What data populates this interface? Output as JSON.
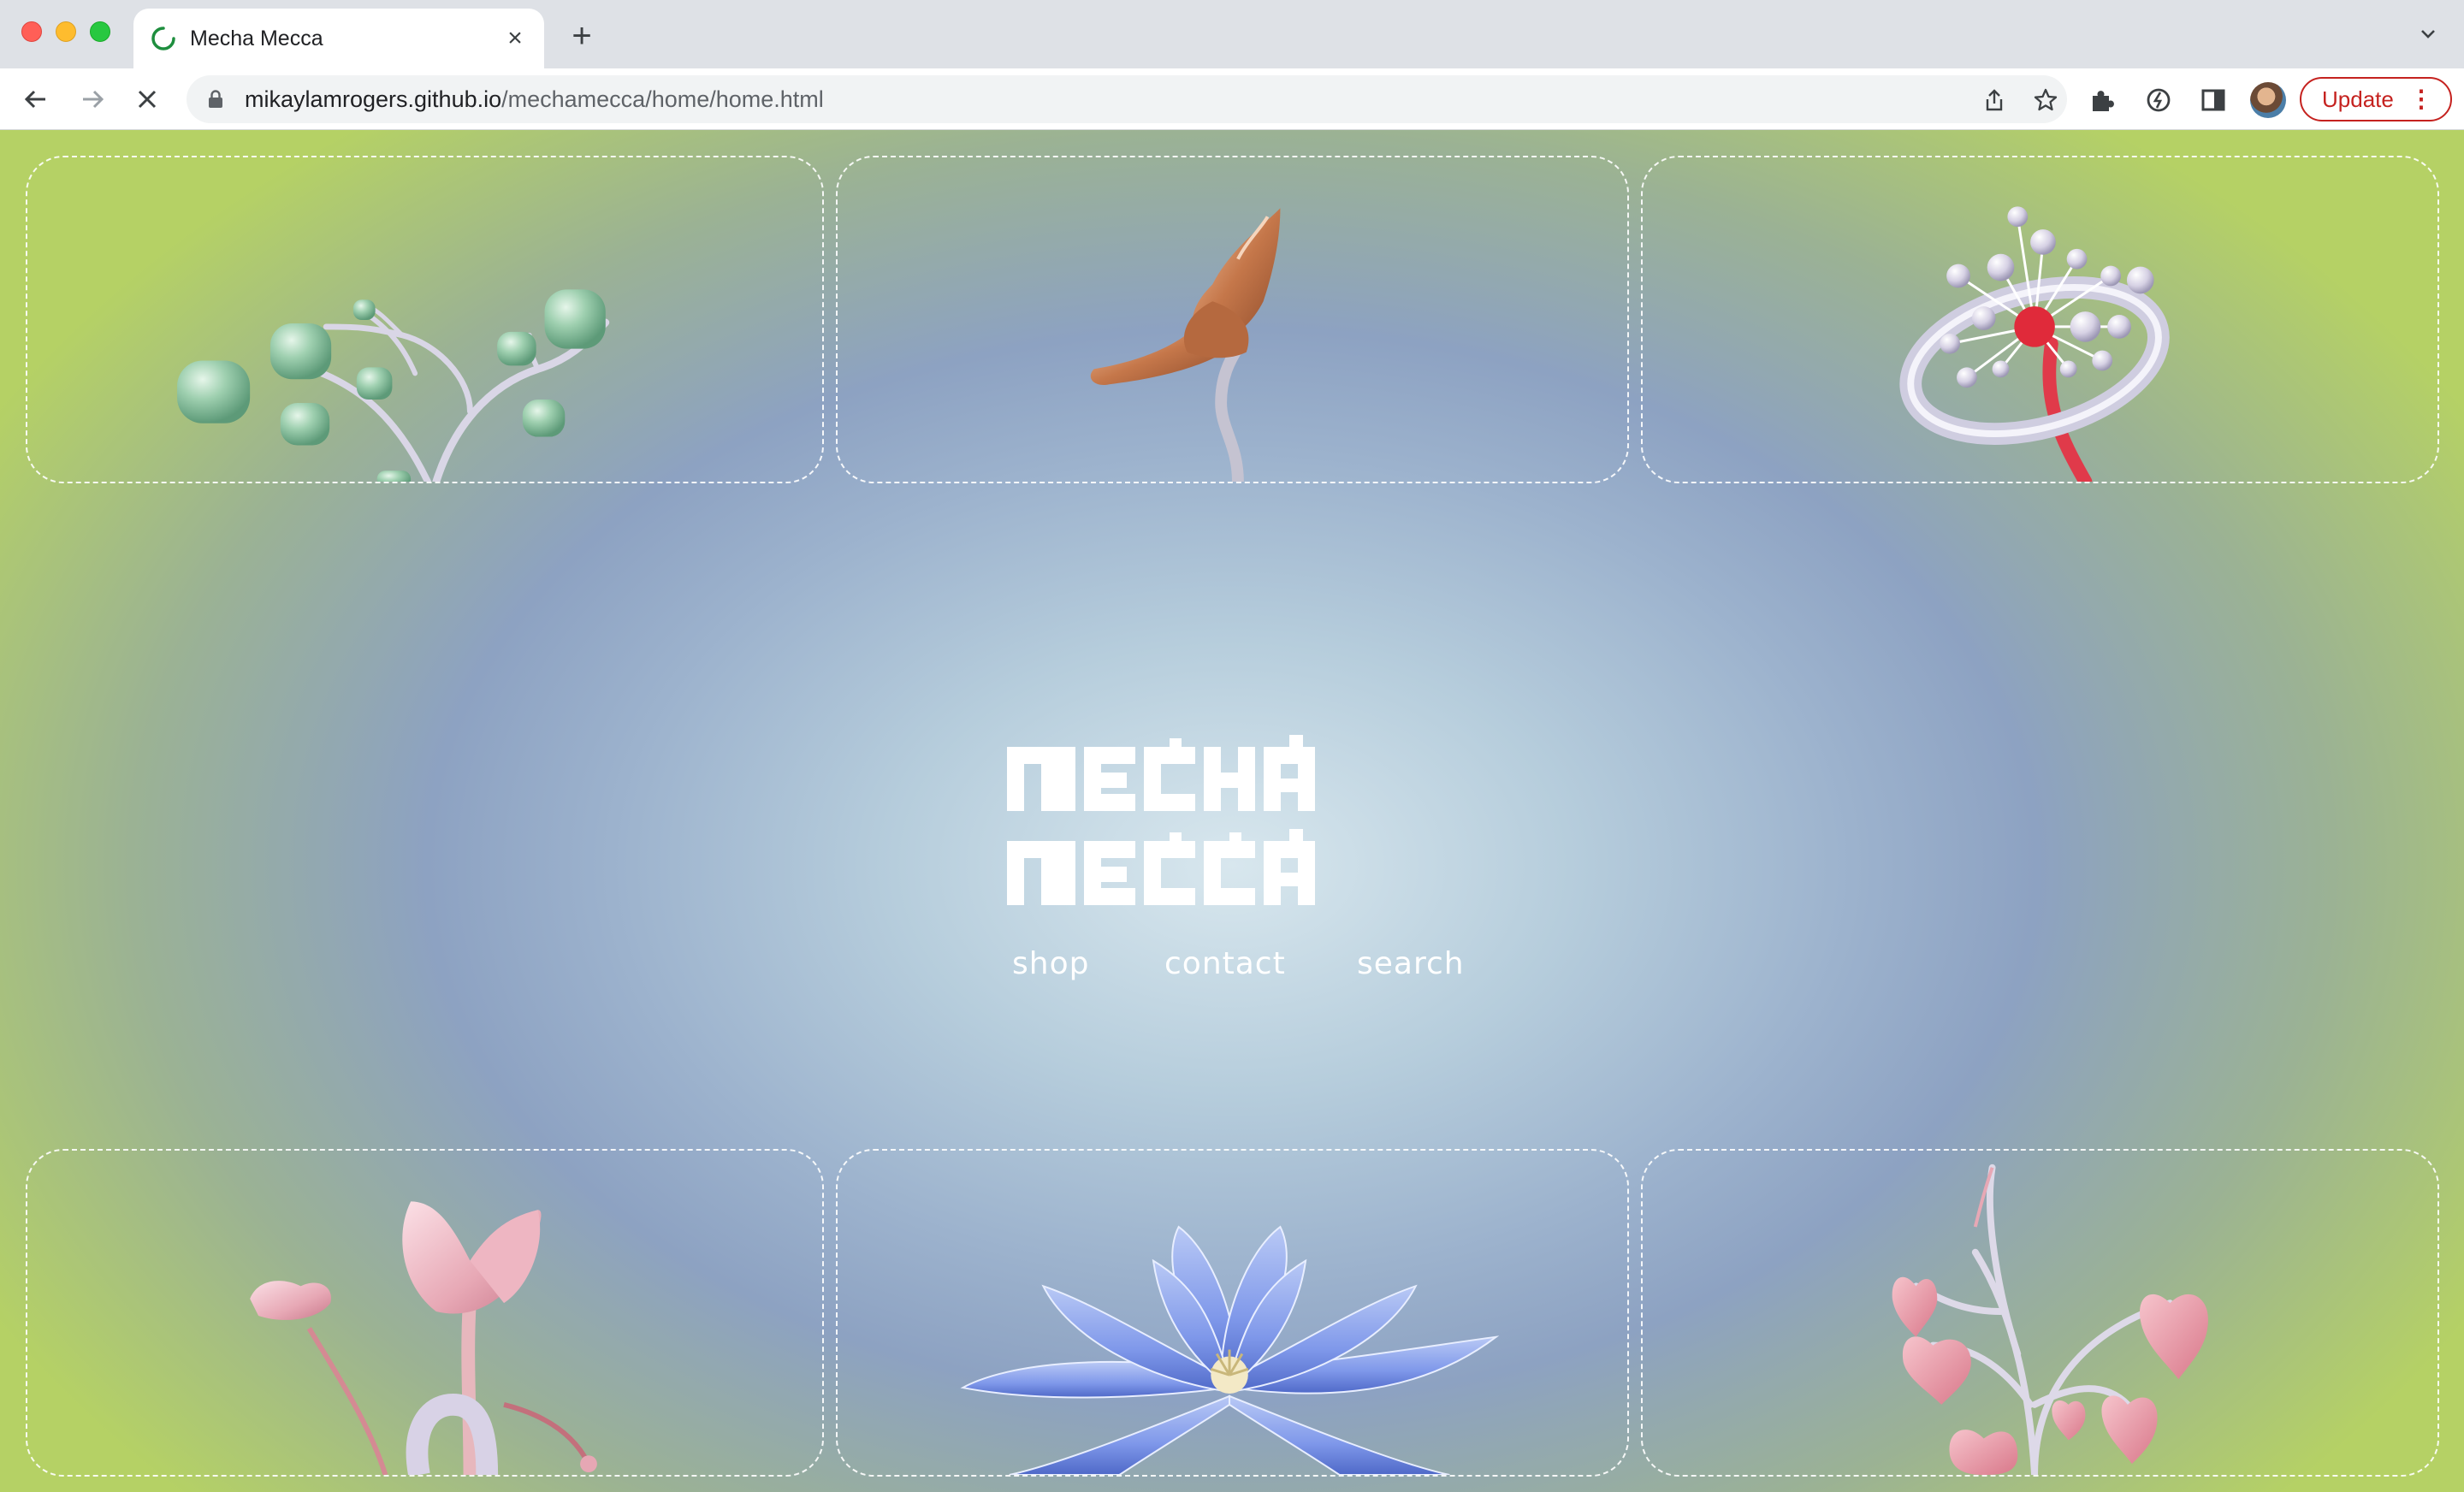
{
  "browser": {
    "tab_title": "Mecha Mecca",
    "new_tab_label": "+",
    "close_tab_label": "×",
    "url_host": "mikaylamrogers.github.io",
    "url_path": "/mechamecca/home/home.html",
    "update_label": "Update",
    "menu_label": "⋮"
  },
  "site": {
    "logo_line1": "MECHA",
    "logo_line2": "MECCA",
    "nav": {
      "shop": "shop",
      "contact": "contact",
      "search": "search"
    }
  },
  "colors": {
    "accent_green": "#b5d165",
    "accent_blue": "#8da2c2",
    "update_red": "#c5221f"
  }
}
